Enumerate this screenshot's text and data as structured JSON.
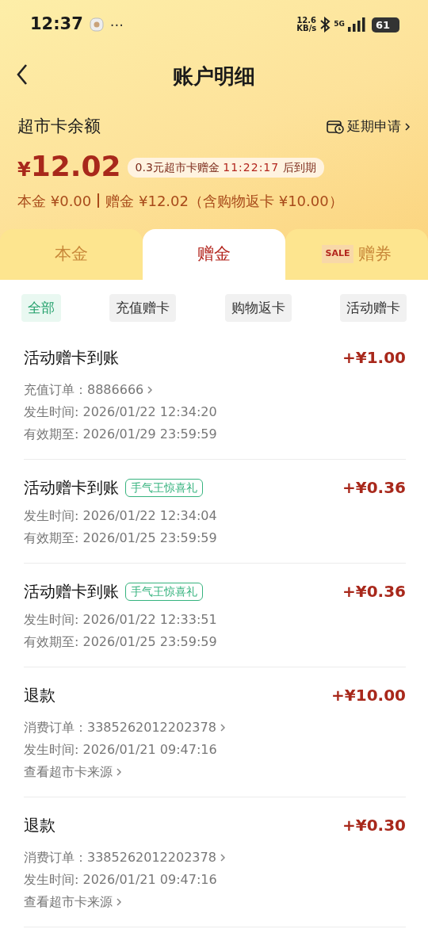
{
  "status_bar": {
    "time": "12:37",
    "more": "···",
    "net_speed": "12.6",
    "net_unit": "KB/s",
    "network": "5G",
    "battery": "61"
  },
  "header": {
    "title": "账户明细"
  },
  "balance": {
    "label": "超市卡余额",
    "extend_link": "延期申请",
    "currency": "¥",
    "amount": "12.02",
    "notice": {
      "text": "0.3元超市卡赠金",
      "countdown": "11:22:17",
      "suffix": "后到期"
    },
    "principal": "本金 ¥0.00",
    "bonus": "赠金 ¥12.02（含购物返卡 ¥10.00）"
  },
  "tabs": [
    {
      "label": "本金",
      "selected": false
    },
    {
      "label": "赠金",
      "selected": true
    },
    {
      "label": "赠券",
      "badge": "SALE",
      "selected": false
    }
  ],
  "filters": [
    {
      "label": "全部",
      "selected": true
    },
    {
      "label": "充值赠卡",
      "selected": false
    },
    {
      "label": "购物返卡",
      "selected": false
    },
    {
      "label": "活动赠卡",
      "selected": false
    }
  ],
  "records": [
    {
      "title": "活动赠卡到账",
      "amount": "+¥1.00",
      "lines": [
        {
          "kind": "link",
          "text": "充值订单：8886666"
        },
        {
          "kind": "text",
          "text": "发生时间: 2026/01/22 12:34:20"
        },
        {
          "kind": "text",
          "text": "有效期至: 2026/01/29 23:59:59"
        }
      ]
    },
    {
      "title": "活动赠卡到账",
      "tag": "手气王惊喜礼",
      "amount": "+¥0.36",
      "lines": [
        {
          "kind": "text",
          "text": "发生时间: 2026/01/22 12:34:04"
        },
        {
          "kind": "text",
          "text": "有效期至: 2026/01/25 23:59:59"
        }
      ]
    },
    {
      "title": "活动赠卡到账",
      "tag": "手气王惊喜礼",
      "amount": "+¥0.36",
      "lines": [
        {
          "kind": "text",
          "text": "发生时间: 2026/01/22 12:33:51"
        },
        {
          "kind": "text",
          "text": "有效期至: 2026/01/25 23:59:59"
        }
      ]
    },
    {
      "title": "退款",
      "amount": "+¥10.00",
      "lines": [
        {
          "kind": "link",
          "text": "消费订单：3385262012202378"
        },
        {
          "kind": "text",
          "text": "发生时间: 2026/01/21 09:47:16"
        },
        {
          "kind": "link",
          "text": "查看超市卡来源"
        }
      ]
    },
    {
      "title": "退款",
      "amount": "+¥0.30",
      "lines": [
        {
          "kind": "link",
          "text": "消费订单：3385262012202378"
        },
        {
          "kind": "text",
          "text": "发生时间: 2026/01/21 09:47:16"
        },
        {
          "kind": "link",
          "text": "查看超市卡来源"
        }
      ]
    }
  ]
}
